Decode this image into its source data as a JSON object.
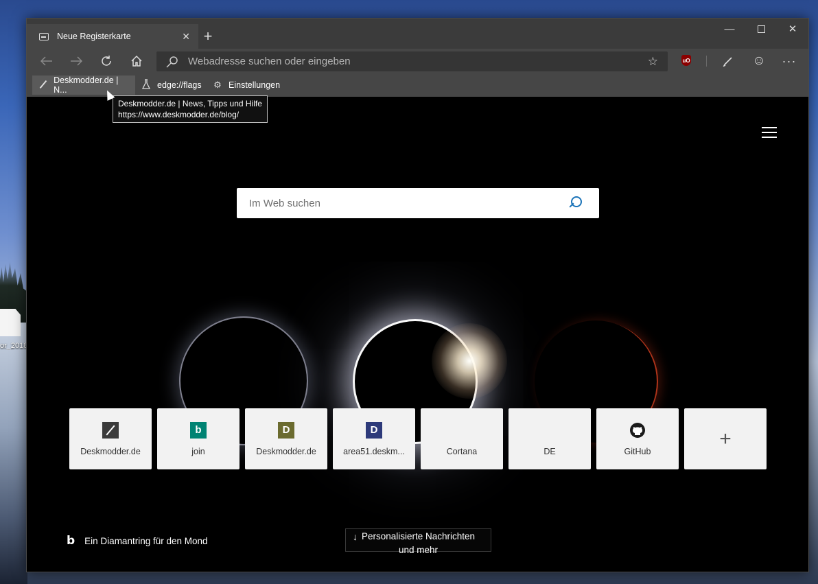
{
  "desktop": {
    "file_label": "or_2018"
  },
  "browser": {
    "tab": {
      "title": "Neue Registerkarte",
      "close": "✕",
      "new_tab": "+"
    },
    "window_controls": {
      "minimize": "—",
      "close": "✕"
    },
    "address_bar": {
      "placeholder": "Webadresse suchen oder eingeben",
      "value": ""
    },
    "toolbar": {
      "ublock_badge": "uO",
      "more": "···"
    },
    "favorites": [
      {
        "label": "Deskmodder.de | N...",
        "icon": "pen-icon"
      },
      {
        "label": "edge://flags",
        "icon": "flask-icon"
      },
      {
        "label": "Einstellungen",
        "icon": "gear-icon"
      }
    ],
    "tooltip": {
      "line1": "Deskmodder.de | News, Tipps und Hilfe",
      "line2": "https://www.deskmodder.de/blog/"
    }
  },
  "newtab": {
    "search": {
      "placeholder": "Im Web suchen"
    },
    "tiles": [
      {
        "label": "Deskmodder.de",
        "icon": "pen-icon"
      },
      {
        "label": "join",
        "icon": "bing-icon",
        "glyph": "b"
      },
      {
        "label": "Deskmodder.de",
        "icon": "letter-d-icon",
        "glyph": "D"
      },
      {
        "label": "area51.deskm...",
        "icon": "letter-d-icon",
        "glyph": "D"
      },
      {
        "label": "Cortana",
        "icon": "microsoft-icon"
      },
      {
        "label": "DE",
        "icon": "microsoft-icon"
      },
      {
        "label": "GitHub",
        "icon": "github-icon"
      },
      {
        "label": "",
        "icon": "plus-icon",
        "glyph": "+"
      }
    ],
    "image_credit": "Ein Diamantring für den Mond",
    "news_button": {
      "line1": "Personalisierte Nachrichten",
      "line2": "und mehr"
    }
  },
  "colors": {
    "chrome_dark": "#3b3b3b",
    "chrome_mid": "#464646",
    "accent_blue": "#1a73b8",
    "ms_red": "#f25022",
    "ms_green": "#7fba00",
    "ms_blue": "#00a4ef",
    "ms_yellow": "#ffb900"
  }
}
